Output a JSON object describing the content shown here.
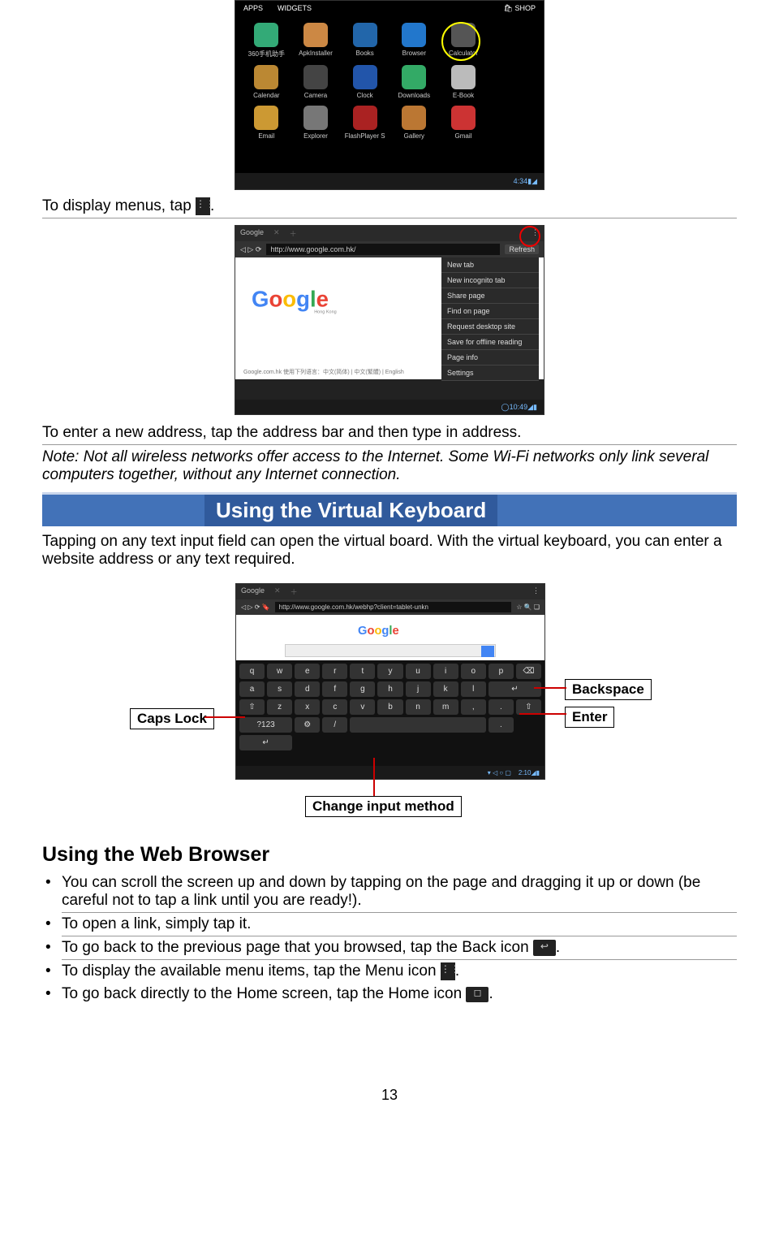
{
  "text": {
    "display_menus": "To display menus, tap ",
    "enter_address": "To enter a new address, tap the address bar and then type in address.",
    "note": "Note: Not all wireless networks offer access to the Internet. Some Wi-Fi networks only link several computers together, without any Internet connection.",
    "section_vk": "Using the Virtual Keyboard",
    "vk_para": "Tapping on any text input field can open the virtual board. With the virtual keyboard, you can enter a website address or any text required.",
    "subhead_browser": "Using the Web Browser",
    "bullet_scroll": "You can scroll the screen up and down by tapping on the page and dragging it up or down (be careful not to tap a link until you are ready!).",
    "bullet_link": "To open a link, simply tap it.",
    "bullet_back_a": "To go back to the previous page that you browsed, tap the Back icon ",
    "bullet_back_b": ".",
    "bullet_menu_a": "To display the available menu items, tap the Menu icon ",
    "bullet_menu_b": ".",
    "bullet_home_a": "To go back directly to the Home screen, tap the Home icon ",
    "bullet_home_b": ".",
    "page_number": "13"
  },
  "callouts": {
    "caps": "Caps Lock",
    "backspace": "Backspace",
    "enter": "Enter",
    "change_im": "Change input method"
  },
  "fig1": {
    "tabs": [
      "APPS",
      "WIDGETS"
    ],
    "shop": "SHOP",
    "apps": [
      {
        "label": "360手机助手",
        "color": "#3a7"
      },
      {
        "label": "ApkInstaller",
        "color": "#c84"
      },
      {
        "label": "Books",
        "color": "#26a"
      },
      {
        "label": "Browser",
        "color": "#27c"
      },
      {
        "label": "Calculator",
        "color": "#555"
      },
      {
        "label": "",
        "color": "#000"
      },
      {
        "label": "Calendar",
        "color": "#b83"
      },
      {
        "label": "Camera",
        "color": "#444"
      },
      {
        "label": "Clock",
        "color": "#25a"
      },
      {
        "label": "Downloads",
        "color": "#3a6"
      },
      {
        "label": "E-Book",
        "color": "#bbb"
      },
      {
        "label": "",
        "color": "#000"
      },
      {
        "label": "Email",
        "color": "#c93"
      },
      {
        "label": "Explorer",
        "color": "#777"
      },
      {
        "label": "FlashPlayer S",
        "color": "#a22"
      },
      {
        "label": "Gallery",
        "color": "#b73"
      },
      {
        "label": "Gmail",
        "color": "#c33"
      },
      {
        "label": "",
        "color": "#000"
      }
    ],
    "clock": "4:34"
  },
  "fig2": {
    "tab": "Google",
    "url": "http://www.google.com.hk/",
    "refresh": "Refresh",
    "menu": [
      "New tab",
      "New incognito tab",
      "Share page",
      "Find on page",
      "Request desktop site",
      "Save for offline reading",
      "Page info",
      "Settings"
    ],
    "footer_text": "Google.com.hk 使用下列语言：中文(简体) | 中文(繁體) | English",
    "clock": "10:49"
  },
  "fig3": {
    "tab": "Google",
    "url": "http://www.google.com.hk/webhp?client=tablet-unkn",
    "rows": [
      [
        "q",
        "w",
        "e",
        "r",
        "t",
        "y",
        "u",
        "i",
        "o",
        "p",
        "⌫"
      ],
      [
        "a",
        "s",
        "d",
        "f",
        "g",
        "h",
        "j",
        "k",
        "l",
        "↵"
      ],
      [
        "⇧",
        "z",
        "x",
        "c",
        "v",
        "b",
        "n",
        "m",
        ",",
        ".",
        "⇧"
      ],
      [
        "?123",
        "⚙",
        "/",
        " ",
        ".",
        "↵"
      ]
    ],
    "clock": "2:10"
  }
}
